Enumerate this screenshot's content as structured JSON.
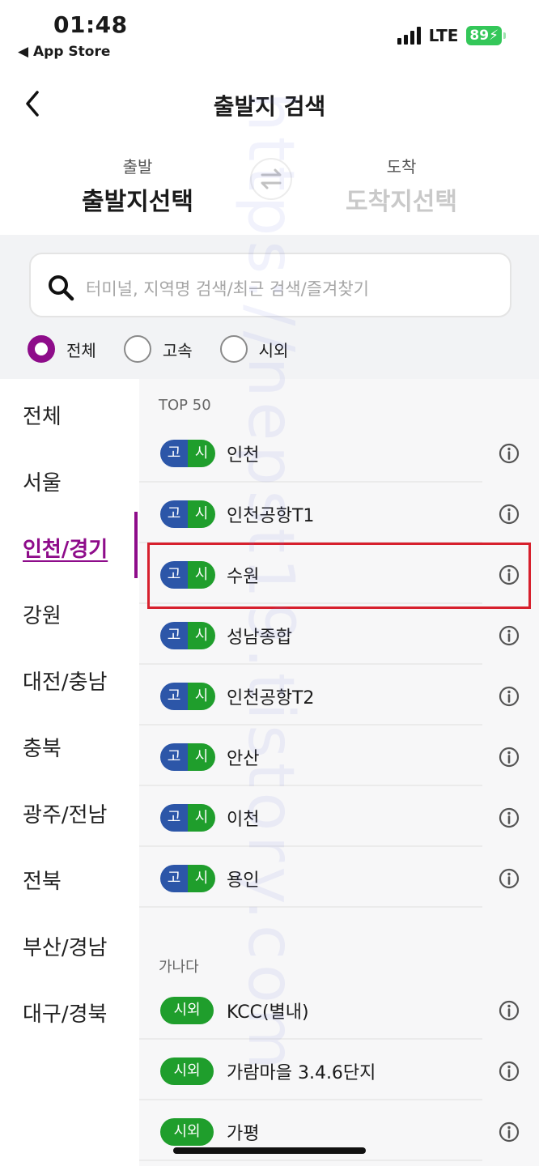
{
  "status_bar": {
    "time": "01:48",
    "back_app": "◀ App Store",
    "network": "LTE",
    "battery": "89"
  },
  "header": {
    "title": "출발지 검색"
  },
  "route": {
    "departure_label": "출발",
    "departure_value": "출발지선택",
    "arrival_label": "도착",
    "arrival_value": "도착지선택"
  },
  "search": {
    "placeholder": "터미널, 지역명 검색/최근 검색/즐겨찾기"
  },
  "filters": [
    {
      "label": "전체",
      "selected": true
    },
    {
      "label": "고속",
      "selected": false
    },
    {
      "label": "시외",
      "selected": false
    }
  ],
  "regions": [
    "전체",
    "서울",
    "인천/경기",
    "강원",
    "대전/충남",
    "충북",
    "광주/전남",
    "전북",
    "부산/경남",
    "대구/경북"
  ],
  "active_region": "인천/경기",
  "top_section": {
    "label": "TOP 50",
    "badge": {
      "express": "고",
      "intercity": "시"
    },
    "items": [
      "인천",
      "인천공항T1",
      "수원",
      "성남종합",
      "인천공항T2",
      "안산",
      "이천",
      "용인"
    ]
  },
  "alpha_section": {
    "label": "가나다",
    "badge": "시외",
    "items": [
      "KCC(별내)",
      "가람마을 3.4.6단지",
      "가평"
    ]
  },
  "highlighted_item": "수원",
  "watermark": "https://nepst19.tistory.com"
}
